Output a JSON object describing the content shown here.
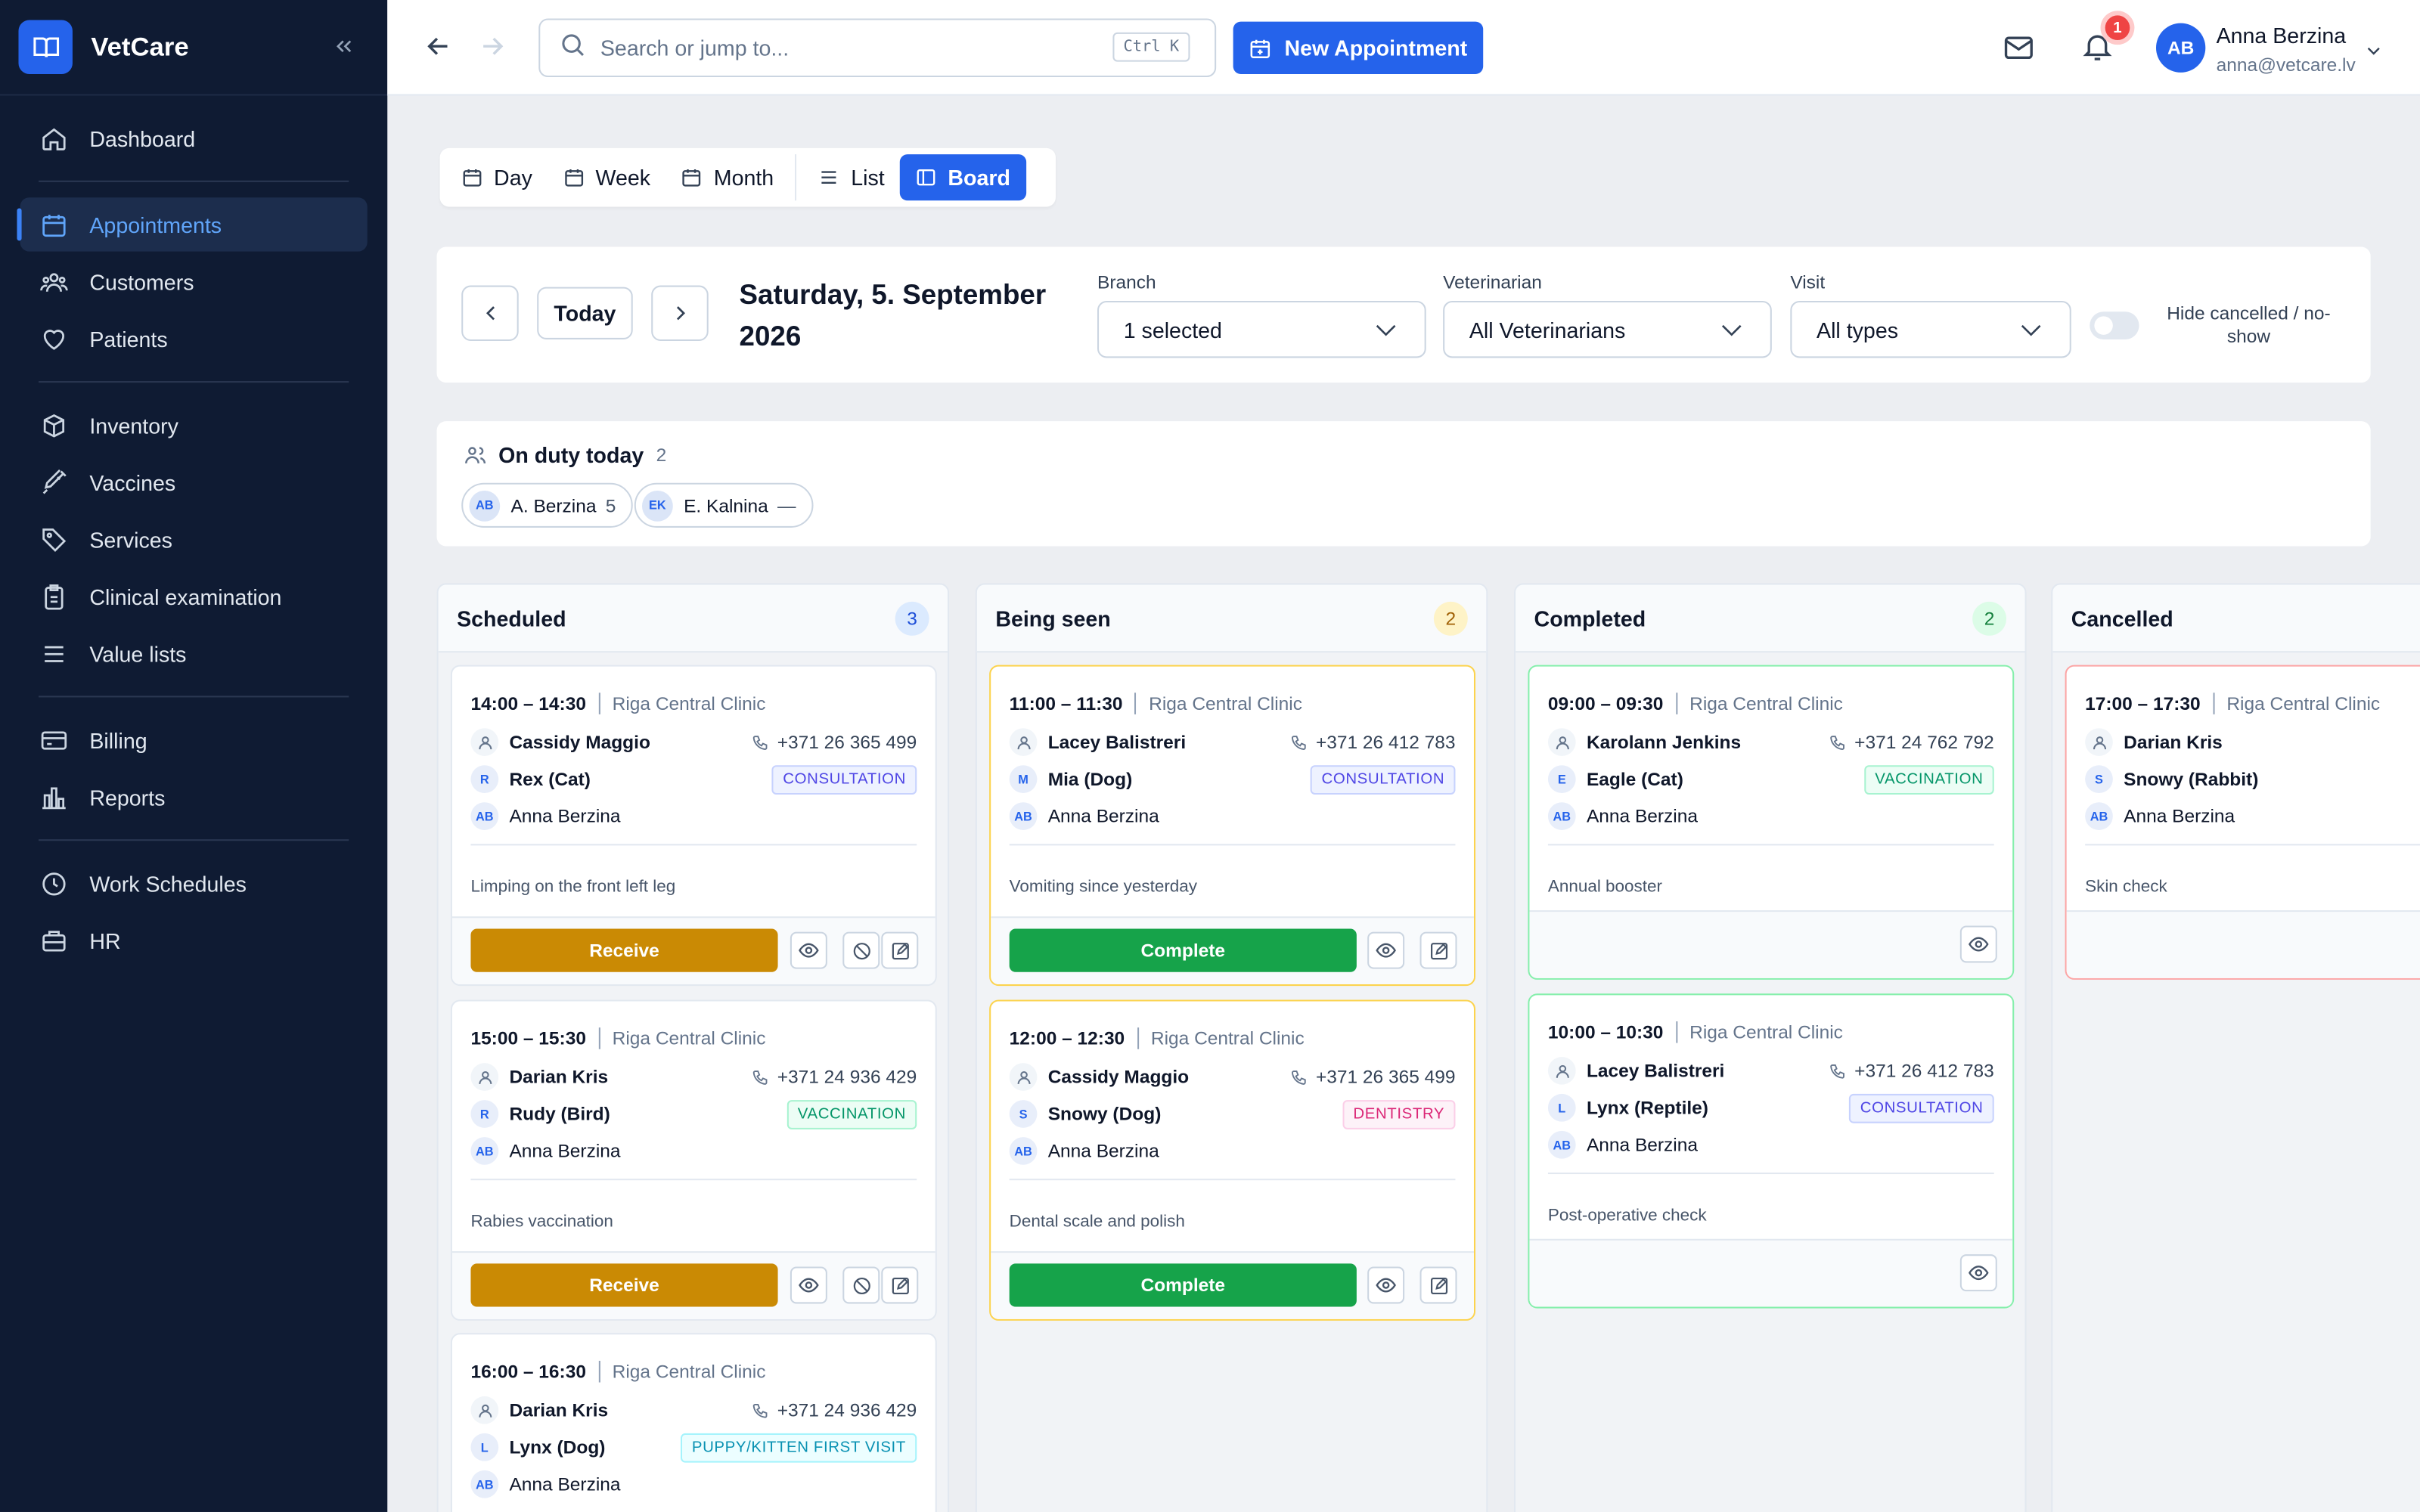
{
  "app": {
    "name": "VetCare"
  },
  "sidebar": {
    "items": [
      {
        "label": "Dashboard",
        "icon": "home-icon"
      },
      {
        "label": "Appointments",
        "icon": "calendar-icon"
      },
      {
        "label": "Customers",
        "icon": "users-icon"
      },
      {
        "label": "Patients",
        "icon": "heart-icon"
      },
      {
        "label": "Inventory",
        "icon": "box-icon"
      },
      {
        "label": "Vaccines",
        "icon": "syringe-icon"
      },
      {
        "label": "Services",
        "icon": "tag-icon"
      },
      {
        "label": "Clinical examination",
        "icon": "clipboard-icon"
      },
      {
        "label": "Value lists",
        "icon": "list-icon"
      },
      {
        "label": "Billing",
        "icon": "card-icon"
      },
      {
        "label": "Reports",
        "icon": "chart-icon"
      },
      {
        "label": "Work Schedules",
        "icon": "clock-icon"
      },
      {
        "label": "HR",
        "icon": "briefcase-icon"
      }
    ]
  },
  "topbar": {
    "search_placeholder": "Search or jump to...",
    "shortcut": "Ctrl K",
    "new_appointment": "New Appointment",
    "notifications": "1",
    "user_initials": "AB",
    "user_name": "Anna Berzina",
    "user_email": "anna@vetcare.lv"
  },
  "views": {
    "day": "Day",
    "week": "Week",
    "month": "Month",
    "list": "List",
    "board": "Board",
    "active": "Board"
  },
  "filters": {
    "today": "Today",
    "date": "Saturday, 5. September 2026",
    "branch_label": "Branch",
    "branch_value": "1 selected",
    "vet_label": "Veterinarian",
    "vet_value": "All Veterinarians",
    "visit_label": "Visit",
    "visit_value": "All types",
    "hide_label": "Hide cancelled / no-show",
    "hide_on": false
  },
  "duty": {
    "title": "On duty today",
    "count": "2",
    "people": [
      {
        "initials": "AB",
        "name": "A. Berzina",
        "count": "5"
      },
      {
        "initials": "EK",
        "name": "E. Kalnina",
        "count": "—"
      }
    ]
  },
  "columns": [
    {
      "title": "Scheduled",
      "count": "3",
      "cards": [
        {
          "time": "14:00 – 14:30",
          "clinic": "Riga Central Clinic",
          "owner": "Cassidy Maggio",
          "phone": "+371 26 365 499",
          "pet_initial": "R",
          "pet": "Rex (Cat)",
          "tag": "CONSULTATION",
          "vet_initials": "AB",
          "vet": "Anna Berzina",
          "note": "Limping on the front left leg",
          "action": "Receive"
        },
        {
          "time": "15:00 – 15:30",
          "clinic": "Riga Central Clinic",
          "owner": "Darian Kris",
          "phone": "+371 24 936 429",
          "pet_initial": "R",
          "pet": "Rudy (Bird)",
          "tag": "VACCINATION",
          "vet_initials": "AB",
          "vet": "Anna Berzina",
          "note": "Rabies vaccination",
          "action": "Receive"
        },
        {
          "time": "16:00 – 16:30",
          "clinic": "Riga Central Clinic",
          "owner": "Darian Kris",
          "phone": "+371 24 936 429",
          "pet_initial": "L",
          "pet": "Lynx (Dog)",
          "tag": "PUPPY/KITTEN FIRST VISIT",
          "vet_initials": "AB",
          "vet": "Anna Berzina"
        }
      ]
    },
    {
      "title": "Being seen",
      "count": "2",
      "cards": [
        {
          "time": "11:00 – 11:30",
          "clinic": "Riga Central Clinic",
          "owner": "Lacey Balistreri",
          "phone": "+371 26 412 783",
          "pet_initial": "M",
          "pet": "Mia (Dog)",
          "tag": "CONSULTATION",
          "vet_initials": "AB",
          "vet": "Anna Berzina",
          "note": "Vomiting since yesterday",
          "action": "Complete"
        },
        {
          "time": "12:00 – 12:30",
          "clinic": "Riga Central Clinic",
          "owner": "Cassidy Maggio",
          "phone": "+371 26 365 499",
          "pet_initial": "S",
          "pet": "Snowy (Dog)",
          "tag": "DENTISTRY",
          "vet_initials": "AB",
          "vet": "Anna Berzina",
          "note": "Dental scale and polish",
          "action": "Complete"
        }
      ]
    },
    {
      "title": "Completed",
      "count": "2",
      "cards": [
        {
          "time": "09:00 – 09:30",
          "clinic": "Riga Central Clinic",
          "owner": "Karolann Jenkins",
          "phone": "+371 24 762 792",
          "pet_initial": "E",
          "pet": "Eagle (Cat)",
          "tag": "VACCINATION",
          "vet_initials": "AB",
          "vet": "Anna Berzina",
          "note": "Annual booster"
        },
        {
          "time": "10:00 – 10:30",
          "clinic": "Riga Central Clinic",
          "owner": "Lacey Balistreri",
          "phone": "+371 26 412 783",
          "pet_initial": "L",
          "pet": "Lynx (Reptile)",
          "tag": "CONSULTATION",
          "vet_initials": "AB",
          "vet": "Anna Berzina",
          "note": "Post-operative check"
        }
      ]
    },
    {
      "title": "Cancelled",
      "cards": [
        {
          "time": "17:00 – 17:30",
          "clinic": "Riga Central Clinic",
          "owner": "Darian Kris",
          "pet_initial": "S",
          "pet": "Snowy (Rabbit)",
          "vet_initials": "AB",
          "vet": "Anna Berzina",
          "note": "Skin check"
        }
      ]
    }
  ],
  "colors": {
    "accent": "#2563eb",
    "receive": "#ca8a04",
    "complete": "#16a34a",
    "sidebar": "#0f1b33"
  }
}
